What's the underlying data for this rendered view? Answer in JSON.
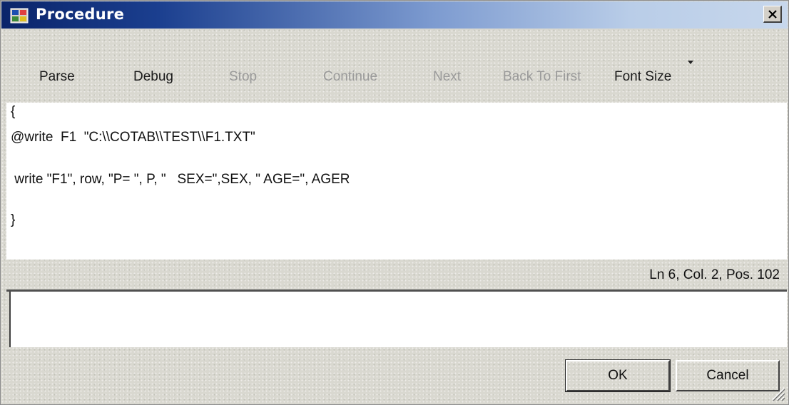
{
  "window": {
    "title": "Procedure",
    "close_label": "X"
  },
  "toolbar": {
    "items": [
      {
        "label": "Parse",
        "enabled": true
      },
      {
        "label": "Debug",
        "enabled": true
      },
      {
        "label": "Stop",
        "enabled": false
      },
      {
        "label": "Continue",
        "enabled": false
      },
      {
        "label": "Next",
        "enabled": false
      },
      {
        "label": "Back To First",
        "enabled": false
      },
      {
        "label": "Font Size",
        "enabled": true
      }
    ]
  },
  "editor": {
    "lines": [
      "{",
      "@write  F1  \"C:\\\\COTAB\\\\TEST\\\\F1.TXT\"",
      "",
      " write \"F1\", row, \"P= \", P, \"   SEX=\",SEX, \" AGE=\", AGER",
      "",
      "}"
    ]
  },
  "status": {
    "position": "Ln 6, Col. 2, Pos. 102"
  },
  "output": {
    "value": ""
  },
  "buttons": {
    "ok_label": "OK",
    "cancel_label": "Cancel"
  },
  "colors": {
    "titlebar_start": "#0a246a",
    "titlebar_end": "#c7d7ec",
    "disabled_text": "#9a9a9a"
  }
}
